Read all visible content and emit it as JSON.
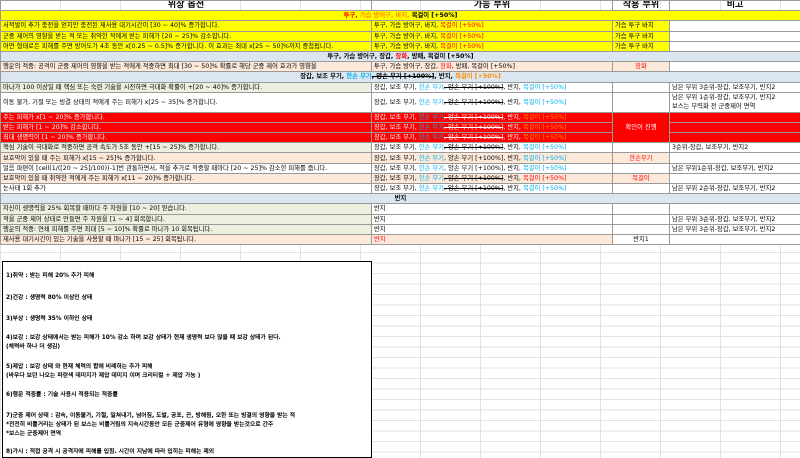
{
  "header": {
    "c1": "위상 옵션",
    "c2": "가능 부위",
    "c3": "착용 부위",
    "c4": "비고"
  },
  "sec1": {
    "a": "투구, ",
    "b": "가슴 방어구, 바지, ",
    "c": "목걸이",
    "d": " [+50%]"
  },
  "r1": {
    "c1": "서적발이 추가 충전을 얻지만 충전된 재사용 대기시간이 [30 ~ 40]% 증가합니다.",
    "c2a": "투구, 가슴 방어구, 바지, ",
    "c2b": "목걸이 [+50%]",
    "c3": "가슴 투구 바지"
  },
  "r2": {
    "c1": "군중 제어의 영향을 받는 적 또는 취약한 적에게 받는 피해가 [20 ~ 25]% 감소합니다.",
    "c2a": "투구, 가슴 방어구, 바지, ",
    "c2b": "목걸이 [+50%]",
    "c3": "가슴 투구 바지"
  },
  "r3": {
    "c1": "어떤 형태로든 피해를 주면 방어도가 4초 동안 x[0.25 ~ 0.5]% 증가합니다. 이 효과는 최대 x[25 ~ 50]%까지 중첩됩니다.",
    "c2a": "투구, 가슴 방어구, 바지, ",
    "c2b": "목걸이 [+50%]",
    "c3": "가슴 투구 바지"
  },
  "sec2": {
    "text": "투구, 가슴 방어구, 장갑, ",
    "b": "장화",
    "c": ", 방패, 목걸이 [+50%]"
  },
  "r4": {
    "c1": "행운의 적중: 공격이 군중 제어의 영향을 받는 적에게 적중하면 최대 [30 ~ 50]% 확률로 해당 군중 제어 효과가 영향을 ",
    "c2a": "투구, 가슴 방어구, 장갑, ",
    "c2b": "장화",
    "c2c": ", 방패, 목걸이 [+50%]",
    "c3": "장화"
  },
  "sec3": {
    "a": "장갑, 보조 무기, ",
    "b": "한손 무기",
    "c": ", 양손 무기 [+100%]",
    "d": ", 반지, ",
    "e": "목걸이 [+50%]"
  },
  "r5": {
    "c1": "마나가 100 이상일 때 핵심 또는 숙련 기술을 시전하면 극대화 확률이 +[20 ~ 40]% 증가합니다.",
    "c2a": "장갑, 보조 무기, ",
    "c2b": "한손 무기",
    "c2c": ", 양손 무기 [+100%]",
    "c2d": ", 반지, ",
    "c2e": "목걸이 [+50%]",
    "c4": "남은 부위 3순위-장갑, 보조무기, 반지2"
  },
  "r6": {
    "c1": "이동 불가, 기절 또는 빙결 상태의 적에게 주는 피해가 x[25 ~ 35]% 증가합니다.",
    "c2a": "장갑, 보조 무기, ",
    "c2b": "한손 무기",
    "c2c": ", 양손 무기 [+100%]",
    "c2d": ", 반지, ",
    "c2e": "목걸이 [+50%]",
    "c4a": "남은 부위 1순위-장갑, 보조무기, 반지2",
    "c4b": "보스는 무력화 전 군중제어 면역"
  },
  "r7": {
    "c1": "주는 피해가 x[1 ~ 20]% 증가합니다.",
    "c2a": "장갑, 보조 무기, ",
    "c2b": "한손 무기",
    "c2c": ", 양손 무기 [+100%]",
    "c2d": ", 반지, ",
    "c2e": "목걸이 [+50%]"
  },
  "r8": {
    "c1": "받는 피해가 [1 ~ 20]% 감소합니다.",
    "c2a": "장갑, 보조 무기, ",
    "c2b": "한손 무기",
    "c2c": ", 양손 무기 [+100%]",
    "c2d": ", 반지, ",
    "c2e": "목걸이 [+50%]",
    "c3": "확인이 진행"
  },
  "r9": {
    "c1": "최대 생명력이 [1 ~ 20]% 증가합니다.",
    "c2a": "장갑, 보조 무기, ",
    "c2b": "한손 무기",
    "c2c": ", 양손 무기 [+100%]",
    "c2d": ", 반지, ",
    "c2e": "목걸이 [+50%]"
  },
  "r10": {
    "c1": "핵심 기술이 극대화로 적중하면 공격 속도가 5초 동안 +[15 ~ 25]% 증가합니다.",
    "c2a": "장갑, 보조 무기, ",
    "c2b": "한손 무기",
    "c2c": ", 양손 무기 [+100%]",
    "c2d": ", 반지, ",
    "c2e": "목걸이 [+50%]",
    "c4": "3순위-장갑, 보조무기, 반지2"
  },
  "r11": {
    "c1": "보호막이 있을 때 주는 피해가 x[15 ~ 25]% 증가합니다.",
    "c2a": "장갑, 보조 무기, ",
    "c2b": "한손 무기",
    "c2c": ", 양손 무기 [+100%]",
    "c2d": ", 반지, ",
    "c2e": "목걸이 [+50%]",
    "c3": "한손무기"
  },
  "r12": {
    "c1": "얼음 파편이 [cell(1/([20 ~ 25]/100))-1]번 관통하면서, 적을 추가로 적중할 때마다 [20 ~ 25]% 감소한 피해를 줍니다.",
    "c2a": "장갑, 보조 무기, ",
    "c2b": "한손 무기",
    "c2c": ", 양손 무기 [+100%]",
    "c2d": ", 반지, ",
    "c2e": "목걸이 [+50%]",
    "c4": "남은 부위1순위-장갑, 보조무기, 반지2"
  },
  "r13": {
    "c1": "보호막이 있을 때 취약한 적에게 주는 피해가 x[11 ~ 20]% 증가합니다.",
    "c2a": "장갑, 보조 무기, ",
    "c2b": "한손 무기",
    "c2c": ", 양손 무기 [+100%]",
    "c2d": ", 반지, ",
    "c2e": "목걸이 [+50%]",
    "c3": "목걸이"
  },
  "r14": {
    "c1": "눈사태 1회 추가",
    "c2a": "장갑, 보조 무기, ",
    "c2b": "한손 무기",
    "c2c": ", 양손 무기 [+100%]",
    "c2d": ", 반지, ",
    "c2e": "목걸이 [+50%]",
    "c4": "남은 부위 2순위-장갑, 보조무기, 반지2"
  },
  "sec4": {
    "text": "반지"
  },
  "r15": {
    "c1": "자신이 생명력을 25% 회복할 때마다 주 자원을 [10 ~ 20] 얻습니다.",
    "c2": "반지"
  },
  "r16": {
    "c1": "적을 군중 제어 상태로 만들면 주 자원을 [1 ~ 4] 회복합니다.",
    "c2": "반지",
    "c4": "남은 부위 3순위-장갑, 보조무기, 반지2"
  },
  "r17": {
    "c1": "행운의 적중: 연쇄 피해를 주면 최대 [5 ~ 10]% 확률로 마나가 10 회복됩니다.",
    "c2": "반지",
    "c4": "남은 부위 3순위-장갑, 보조무기, 반지2"
  },
  "r18": {
    "c1": "재사용 대기시간이 있는 기술을 사용할 때 마나가 [15 ~ 25] 회복됩니다.",
    "c2": "반지",
    "c3": "반지1"
  },
  "notes": [
    "1)취약 : 받는 피해 20% 추가 피해",
    "2)건강 : 생명력 80% 이상인 상태",
    "3)부상 : 생명력 35% 이하인 상태",
    "4)보강 : 보강 상태에서는 받는 피해가 10% 감소 하며 보강 상태가 현재 생명력 보다 많을 때 보강 상태가 된다.",
    "   (체력바 하나 더 생김)",
    "5)제압 : 보강 상태 와 현재 체력의 합에 비례하는 추가 피해",
    "   (바우다 보던 나오는 파란색 데미지가 제압 데미지 이며 크리티컬 + 제압 가능 )",
    "6)행운 적중률 : 기술 사용시 적용되는 적중률",
    "7)군중 제어 상태 : 감속, 이동불가, 기절, 밀쳐내기, 넘어짐, 도발, 공포, 끈, 방해됨, 오한 또는 빙결의 영향을 받는 적",
    "   *전전히 비틀거리는 상태가 된 보스는 비틀거림의 지속시간동안 모든 군중제어 유형에 영향을 받는것으로 간주",
    "   *보스는 군중제어 면역",
    "8)가시 : 적접 공격 시 공격자에 피해를 입힘. 시간이 지남에 따라 입히는 피해는 제외"
  ]
}
